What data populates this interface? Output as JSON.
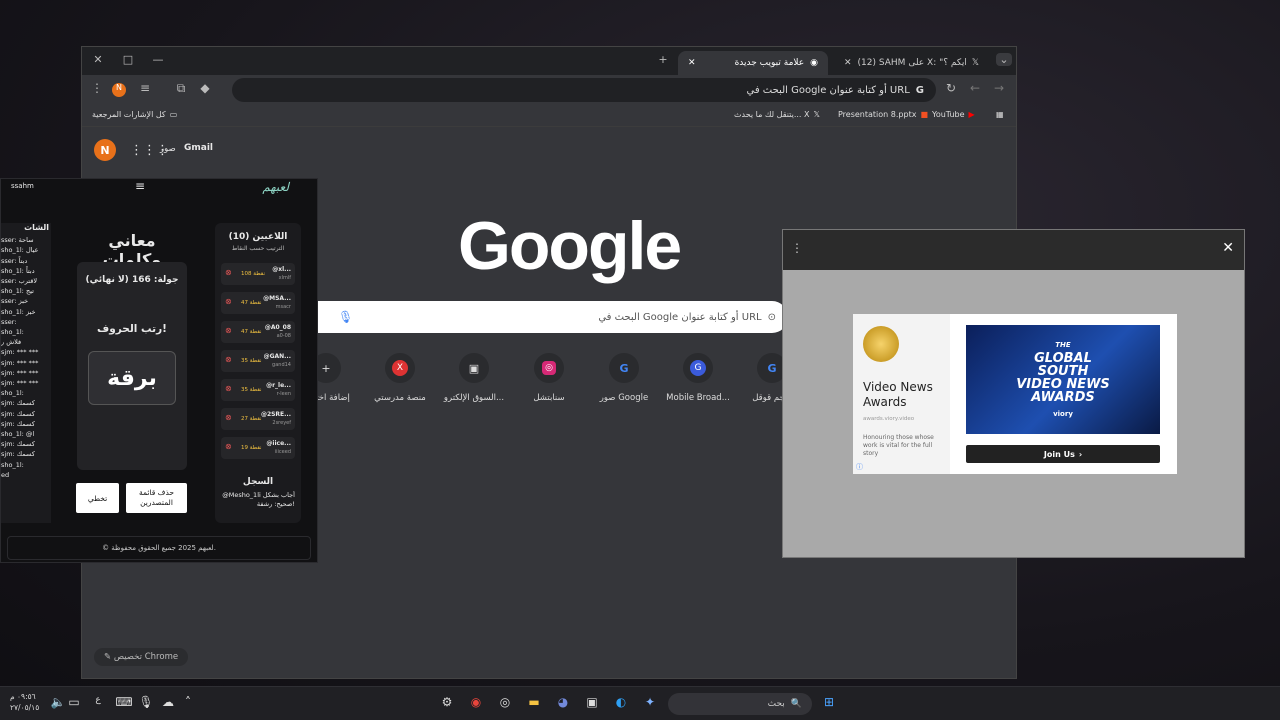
{
  "browser": {
    "tabs": [
      {
        "label": "علامة تبويب جديدة",
        "active": true
      },
      {
        "label": "(12) SAHM على X: \"رايكم ؟\"",
        "active": false
      }
    ],
    "address_placeholder": "البحث في Google أو كتابة عنوان URL",
    "bookmarks": {
      "all_bookmarks": "كل الإشارات المرجعية",
      "items": [
        "YouTube",
        "Presentation 8.pptx",
        "يتنقل لك ما يحدث... X"
      ]
    },
    "profile_initial": "N"
  },
  "ntp": {
    "gmail": "Gmail",
    "images": "صور",
    "logo": "Google",
    "search_placeholder": "البحث في Google أو كتابة عنوان URL",
    "shortcuts": [
      {
        "label": "إضافة اختصار",
        "icon": "plus-icon"
      },
      {
        "label": "منصة مدرستي",
        "icon": "x-app-icon"
      },
      {
        "label": "السوق الإلكترو...",
        "icon": "store-icon"
      },
      {
        "label": "سنابتشل",
        "icon": "instagram-icon"
      },
      {
        "label": "صور Google",
        "icon": "google-icon"
      },
      {
        "label": "Mobile Broad...",
        "icon": "g-blue-icon"
      },
      {
        "label": "ترجم قوقل",
        "icon": "google-icon"
      }
    ],
    "customize": "تخصيص Chrome"
  },
  "game": {
    "user": "ssahm",
    "logo": "لعبهم",
    "chat_title": "الشات",
    "chat_lines": [
      "sser: ساحة",
      "sho_1l: عيال",
      "sser: دبتاً",
      "sho_1l: دبتاً",
      "sser: لاقترب",
      "sho_1l: تيج",
      "sser: خبز",
      "sho_1l: خبز",
      "sser:",
      "sho_1l:",
      "فلاش ر",
      "sjm: *** ***",
      "sjm: *** ***",
      "sjm: *** ***",
      "sjm: *** ***",
      "sho_1l:",
      "sjm: كسمك",
      "sjm: كسمك",
      "sjm: كسمك",
      "sho_1l: @l",
      "sjm: كسمك",
      "sjm: كسمك",
      "sho_1l:",
      "ed"
    ],
    "title": "معاني وكلمات",
    "round": "جولة: 166 (لا نهائي)",
    "instruction": "رتب الحروف!",
    "word": "برقة",
    "delete_leaderboard": "حذف قائمة المتصدرين",
    "skip": "تخطي",
    "players_title": "اللاعبين (10)",
    "players_sub": "الترتيب حسب النقاط",
    "players": [
      {
        "name": "@xl...",
        "points": "108 نقطة",
        "sub": "xlmlf"
      },
      {
        "name": "@MSA...",
        "points": "47 نقطة",
        "sub": "msacr"
      },
      {
        "name": "@A0_08",
        "points": "47 نقطة",
        "sub": "a0-08"
      },
      {
        "name": "@GAN...",
        "points": "35 نقطة",
        "sub": "gand14"
      },
      {
        "name": "@r_le...",
        "points": "35 نقطة",
        "sub": "r-leen"
      },
      {
        "name": "@2SRE...",
        "points": "27 نقطة",
        "sub": "2sreyef"
      },
      {
        "name": "@iice...",
        "points": "19 نقطة",
        "sub": "iiiceed"
      }
    ],
    "log_title": "السجل",
    "log_text": "@Mesho_1li أجاب بشكل صحيح: رشفة!",
    "footer": "© لعبهم 2025 جميع الحقوق محفوظة."
  },
  "ad": {
    "brand": "Video News Awards",
    "url": "awards.viory.video",
    "desc": "Honouring those whose work is vital for the full story",
    "image_text": [
      "THE",
      "GLOBAL",
      "SOUTH",
      "VIDEO NEWS",
      "AWARDS"
    ],
    "image_brand": "viory",
    "cta": "Join Us"
  },
  "taskbar": {
    "search": "بحث",
    "time": "٠٩:٥٦ م",
    "date": "٢٧/٠٥/١٥",
    "lang": "ع"
  }
}
